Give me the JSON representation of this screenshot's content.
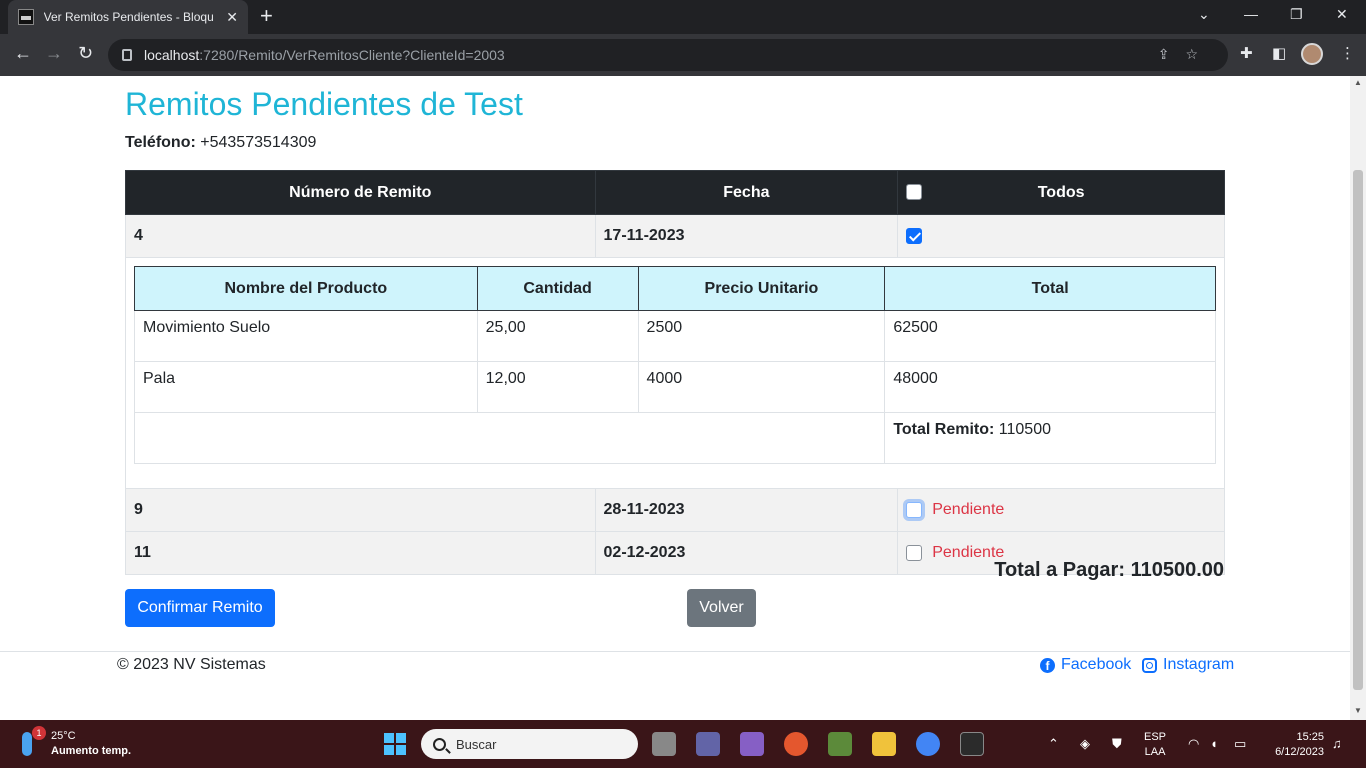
{
  "browser": {
    "tab_title": "Ver Remitos Pendientes - Bloque",
    "url_host": "localhost",
    "url_path": ":7280/Remito/VerRemitosCliente?ClienteId=2003"
  },
  "page": {
    "title": "Remitos Pendientes de Test",
    "phone_label": "Teléfono:",
    "phone_value": "+543573514309"
  },
  "table": {
    "headers": [
      "Número de Remito",
      "Fecha",
      "Todos"
    ],
    "remitos": [
      {
        "numero": "4",
        "fecha": "17-11-2023",
        "checked": true,
        "status": "",
        "items_headers": [
          "Nombre del Producto",
          "Cantidad",
          "Precio Unitario",
          "Total"
        ],
        "items": [
          {
            "nombre": "Movimiento Suelo",
            "cantidad": "25,00",
            "precio": "2500",
            "total": "62500"
          },
          {
            "nombre": "Pala",
            "cantidad": "12,00",
            "precio": "4000",
            "total": "48000"
          }
        ],
        "total_label": "Total Remito:",
        "total_value": "110500"
      },
      {
        "numero": "9",
        "fecha": "28-11-2023",
        "checked": false,
        "status": "Pendiente"
      },
      {
        "numero": "11",
        "fecha": "02-12-2023",
        "checked": false,
        "status": "Pendiente"
      }
    ]
  },
  "summary": {
    "label": "Total a Pagar:",
    "value": "110500.00"
  },
  "buttons": {
    "confirm": "Confirmar Remito",
    "back": "Volver"
  },
  "footer": {
    "copyright": "© 2023 NV Sistemas",
    "facebook": "Facebook",
    "instagram": "Instagram"
  },
  "taskbar": {
    "temperature": "25°C",
    "weather_text": "Aumento temp.",
    "weather_badge": "1",
    "search_placeholder": "Buscar",
    "lang": "ESP",
    "lang_sub": "LAA",
    "time": "15:25",
    "date": "6/12/2023"
  },
  "colors": {
    "title": "#1fb5d6",
    "primary": "#0d6efd",
    "secondary": "#6c757d",
    "danger": "#dc3545",
    "table_head": "#212529",
    "inner_head": "#cff4fc"
  }
}
